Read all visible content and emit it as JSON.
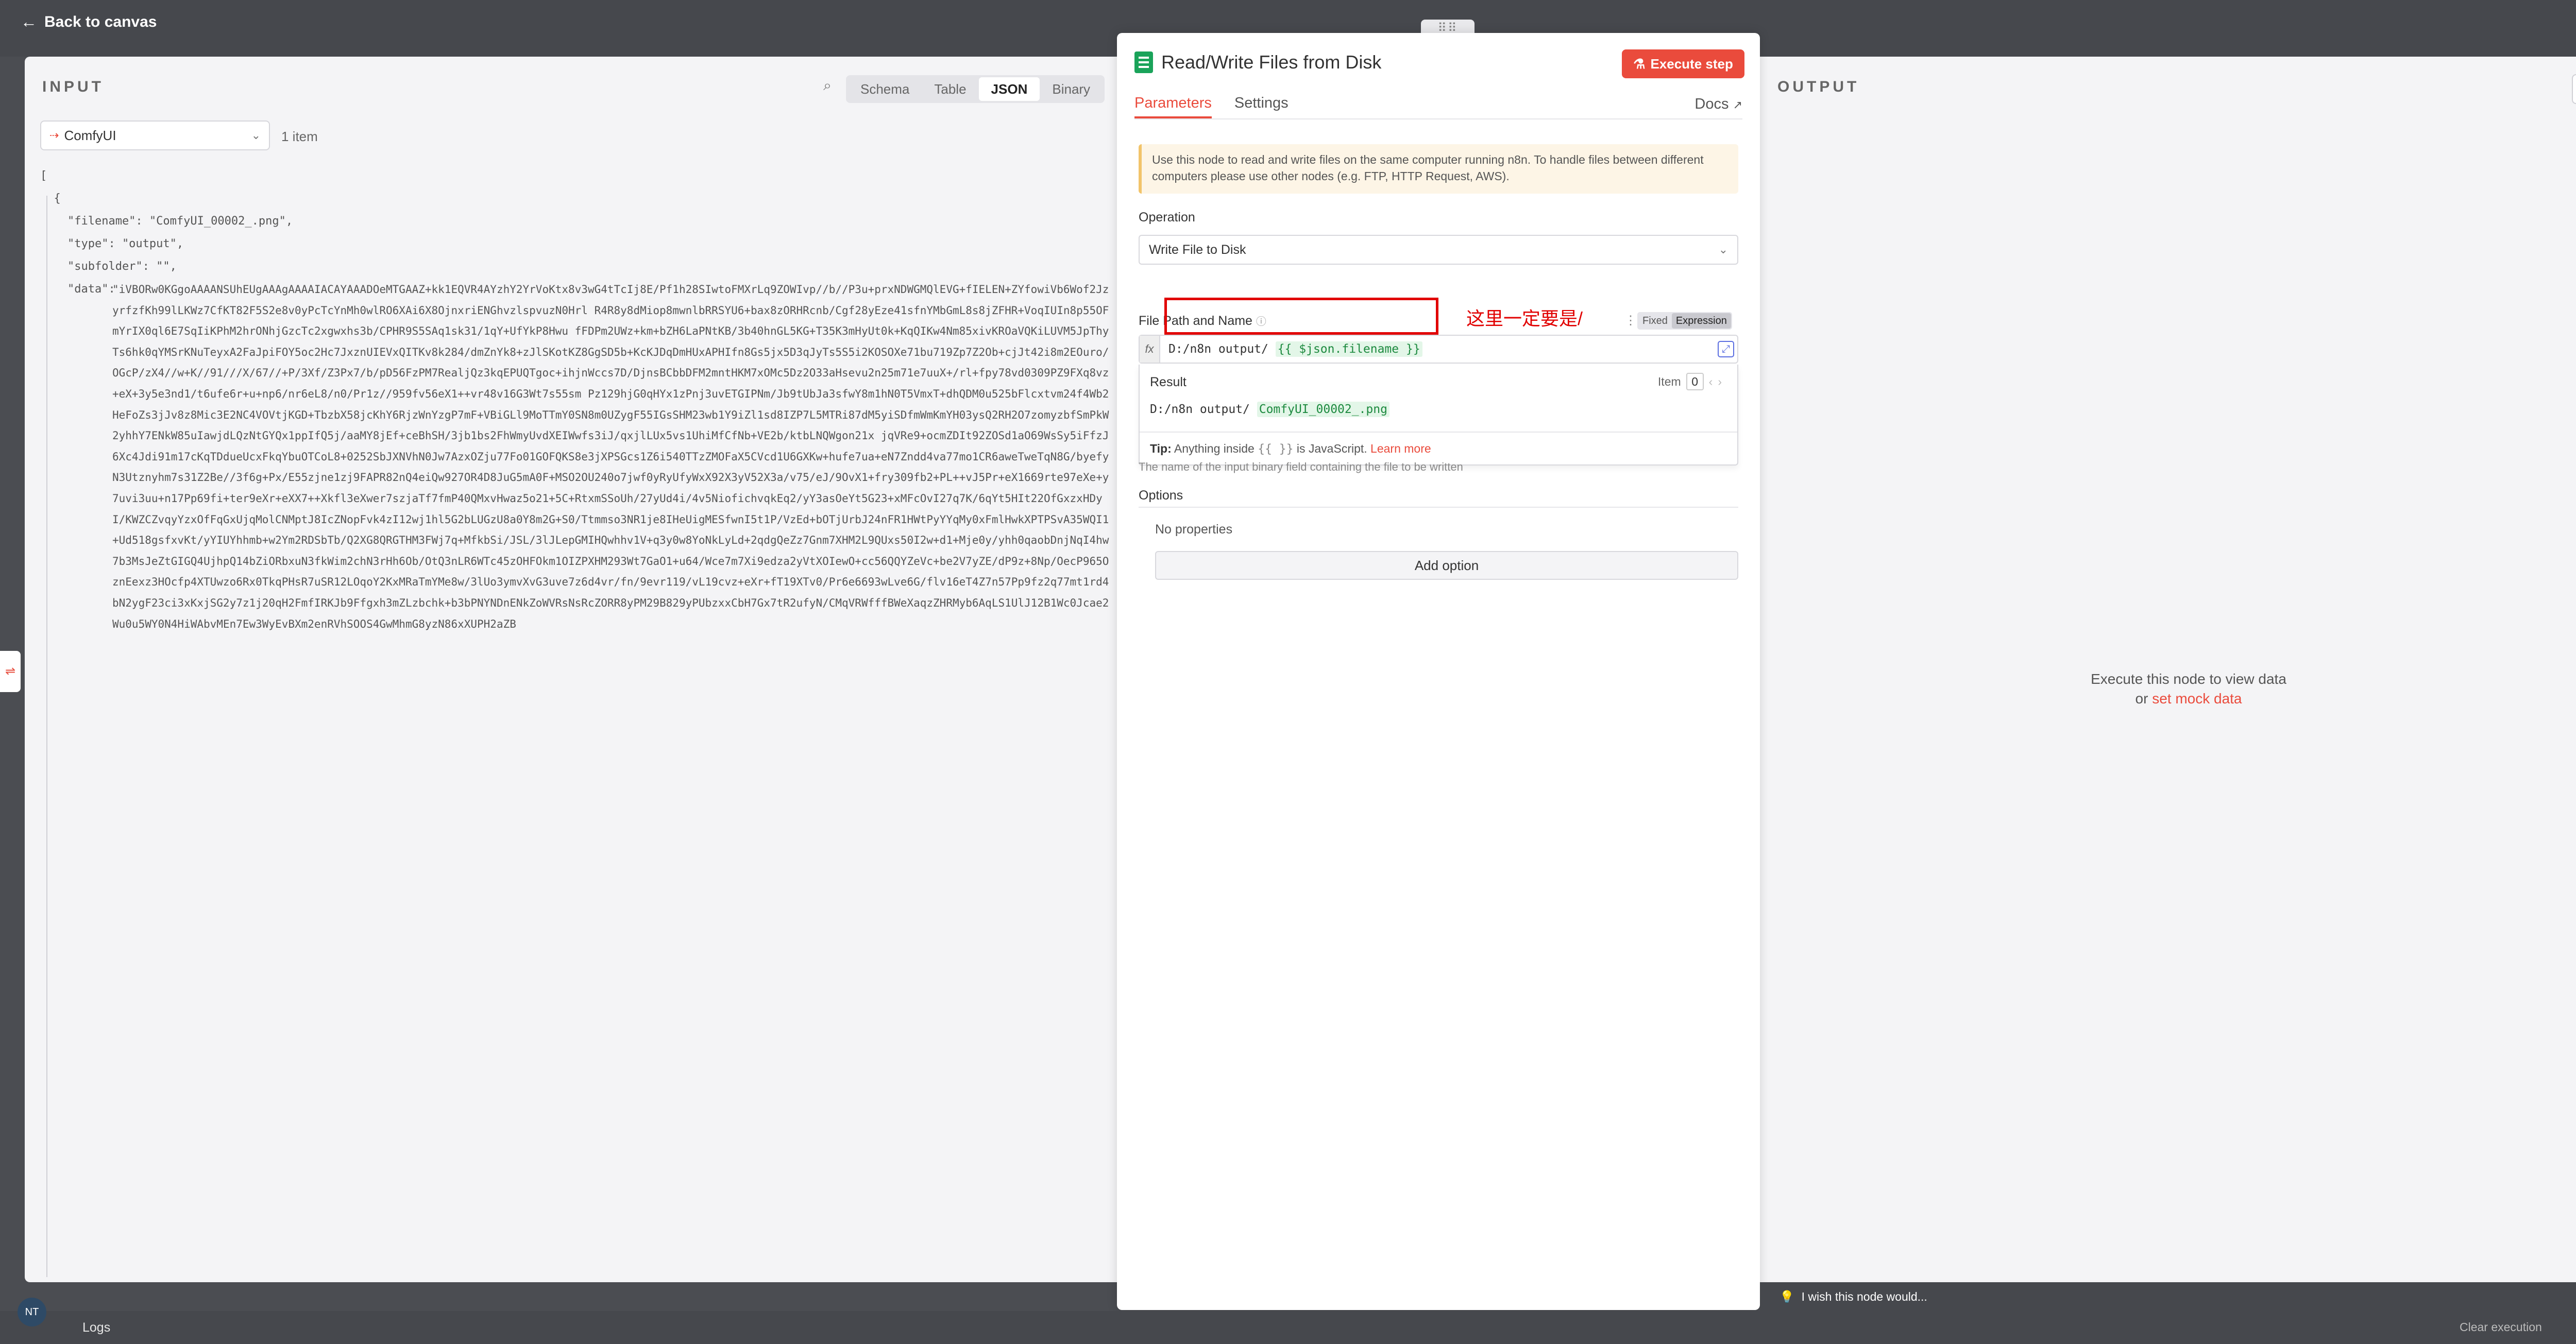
{
  "canvas": {
    "back_label": "Back to canvas",
    "drag_handle": "⠿⠿"
  },
  "input_panel": {
    "title": "INPUT",
    "tabs": [
      "Schema",
      "Table",
      "JSON",
      "Binary"
    ],
    "active_tab": "JSON",
    "node_name": "ComfyUI",
    "item_count": "1 item",
    "json_lines": [
      "[",
      "  {",
      "    \"filename\": \"ComfyUI_00002_.png\",",
      "    \"type\": \"output\",",
      "    \"subfolder\": \"\",",
      "    \"data\":"
    ],
    "data_base64": "\"iVBORw0KGgoAAAANSUhEUgAAAgAAAAIACAYAAADOeMTGAAZ+kk1EQVR4AYzhY2YrVoKtx8v3wG4tTcIj8E/Pf1h28SIwtoFMXrLq9ZOWIvp//b//P3u+prxNDWGMQlEVG+fIELEN+ZYfowiVb6Wof2JzyrfzfKh99lLKWz7CfKT82F5S2e8v0yPcTcYnMh0wlRO6XAi6X8OjnxriENGhvzlspvuzN0Hrl R4R8y8dMiop8mwnlbRRSYU6+bax8zORHRcnb/Cgf28yEze41sfnYMbGmL8s8jZFHR+VoqIUIn8p55OFmYrIX0ql6E7SqIiKPhM2hrONhjGzcTc2xgwxhs3b/CPHR9S5SAq1sk31/1qY+UfYkP8Hwu fFDPm2UWz+km+bZH6LaPNtKB/3b40hnGL5KG+T35K3mHyUt0k+KqQIKw4Nm85xivKROaVQKiLUVM5JpThyTs6hk0qYMSrKNuTeyxA2FaJpiFOY5oc2Hc7JxznUIEVxQITKv8k284/dmZnYk8+zJlSKotKZ8GgSD5b+KcKJDqDmHUxAPHIfn8Gs5jx5D3qJyTs5S5i2KOSOXe71bu719Zp7Z2Ob+cjJt42i8m2EOuro/OGcP/zX4//w+K//91///X/67//+P/3Xf/Z3Px7/b/pD56FzPM7RealjQz3kqEPUQTgoc+ihjnWccs7D/DjnsBCbbDFM2mntHKM7xOMc5Dz2O33aHsevu2n25m71e7uuX+/rl+fpy78vd0309PZ9FXq8vz+eX+3y5e3nd1/t6ufe6r+u+np6/nr6eL8/n0/Pr1z//959fv56eX1++vr48v16G3Wt7s55sm Pz129hjG0qHYx1zPnj3uvETGIPNm/Jb9tUbJa3sfwY8m1hN0T5VmxT+dhQDM0u525bFlcxtvm24f4Wb2HeFoZs3jJv8z8Mic3E2NC4VOVtjKGD+TbzbX58jcKhY6RjzWnYzgP7mF+VBiGLl9MoTTmY0SN8m0UZygF55IGsSHM23wb1Y9iZl1sd8IZP7L5MTRi87dM5yiSDfmWmKmYH03ysQ2RH2O7zomyzbfSmPkW2yhhY7ENkW85uIawjdLQzNtGYQx1ppIfQ5j/aaMY8jEf+ceBhSH/3jb1bs2FhWmyUvdXEIWwfs3iJ/qxjlLUx5vs1UhiMfCfNb+VE2b/ktbLNQWgon21x jqVRe9+ocmZDIt92ZOSd1aO69WsSy5iFfzJ6Xc4Jdi91m17cKqTDdueUcxFkqYbuOTCoL8+0252SbJXNVhN0Jw7AzxOZju77Fo01GOFQKS8e3jXPSGcs1Z6i540TTzZMOFaX5CVcd1U6GXKw+hufe7ua+eN7Zndd4va77mo1CR6aweTweTqN8G/byefyN3Utznyhm7s31Z2Be//3f6g+Px/E55zjne1zj9FAPR82nQ4eiQw927OR4D8JuG5mA0F+MSO2OU240o7jwf0yRyUfyWxX92X3yV52X3a/v75/eJ/9OvX1+fry309fb2+PL++vJ5Pr+eX1669rte97eXe+y7uvi3uu+n17Pp69fi+ter9eXr+eXX7++Xkfl3eXwer7szjaTf7fmP40QMxvHwaz5o21+5C+RtxmSSoUh/27yUd4i/4v5NiofichvqkEq2/yY3asOeYt5G23+xMFcOvI27q7K/6qYt5HIt22OfGxzxHDyI/KWZCZvqyYzxOfFqGxUjqMolCNMptJ8IcZNopFvk4zI12wj1hl5G2bLUGzU8a0Y8m2G+S0/Ttmmso3NR1je8IHeUigMESfwnI5t1P/VzEd+bOTjUrbJ24nFR1HWtPyYYqMy0xFmlHwkXPTPSvA35WQI1+Ud518gsfxvKt/yYIUYhhmb+w2Ym2RDSbTb/Q2XG8QRGTHM3FWj7q+MfkbSi/JSL/3lJLepGMIHQwhhv1V+q3y0w8YoNkLyLd+2qdgQeZz7Gnm7XHM2L9QUxs50I2w+d1+Mje0y/yhh0qaobDnjNqI4hw7b3MsJeZtGIGQ4UjhpQ14bZiORbxuN3fkWim2chN3rHh6Ob/OtQ3nLR6WTc45zOHFOkm1OIZPXHM293Wt7GaO1+u64/Wce7m7Xi9edza2yVtXOIewO+cc56QQYZeVc+be2V7yZE/dP9z+8Np/OecP965OznEexz3HOcfp4XTUwzo6Rx0TkqPHsR7uSR12LOqoY2KxMRaTmYMe8w/3lUo3ymvXvG3uve7z6d4vr/fn/9evr119/vL19cvz+eXr+fT19XTv0/Pr6e6693wLve6G/flv16eT4Z7n57Pp9fz2q77mt1rd4bN2ygF23ci3xKxjSG2y7z1j20qH2FmfIRKJb9Ffgxh3mZLzbchk+b3bPNYNDnENkZoWVRsNsRcZORR8yPM29B829yPUbzxxCbH7Gx7tR2ufyN/CMqVRWfffBWeXaqzZHRMyb6AqLS1UlJ12B1Wc0Jcae2Wu0u5WY0N4HiWAbvMEn7Ew3WyEvBXm2enRVhSOOS4GwMhmG8yzN86xXUPH2aZB"
  },
  "node_modal": {
    "title": "Read/Write Files from Disk",
    "execute_label": "Execute step",
    "tabs": [
      "Parameters",
      "Settings"
    ],
    "active_tab": "Parameters",
    "docs_label": "Docs",
    "notice": "Use this node to read and write files on the same computer running n8n. To handle files between different computers please use other nodes (e.g. FTP, HTTP Request, AWS).",
    "operation_label": "Operation",
    "operation_value": "Write File to Disk",
    "path_label": "File Path and Name",
    "mode_fixed": "Fixed",
    "mode_expression": "Expression",
    "path_prefix": "D:/n8n output/ ",
    "path_expression": "{{ $json.filename }}",
    "annotation": "这里一定要是/",
    "result_label": "Result",
    "item_label": "Item",
    "item_index": "0",
    "result_prefix": "D:/n8n output/ ",
    "result_value": "ComfyUI_00002_.png",
    "tip_bold": "Tip:",
    "tip_text": " Anything inside ",
    "tip_code": "{{ }}",
    "tip_text2": " is JavaScript. ",
    "tip_link": "Learn more",
    "hidden_hint": "The name of the input binary field containing the file to be written",
    "options_label": "Options",
    "no_properties": "No properties",
    "add_option": "Add option",
    "wish_text": "I wish this node would..."
  },
  "output_panel": {
    "title": "OUTPUT",
    "message": "Execute this node to view data",
    "or_label": "or ",
    "mock_link": "set mock data"
  },
  "footer": {
    "logs_label": "Logs",
    "clear_label": "Clear execution",
    "avatar_initials": "NT"
  },
  "colors": {
    "accent": "#ea4b3c",
    "canvas": "#46484d",
    "panel_bg": "#f4f4f6",
    "annotation_red": "#e10000",
    "expr_green": "#1d8a3f"
  },
  "icons": [
    "arrow-left-icon",
    "search-icon",
    "chevron-down-icon",
    "file-disk-icon",
    "flask-icon",
    "external-link-icon",
    "info-icon",
    "pencil-icon",
    "lightbulb-icon",
    "expand-icon"
  ]
}
